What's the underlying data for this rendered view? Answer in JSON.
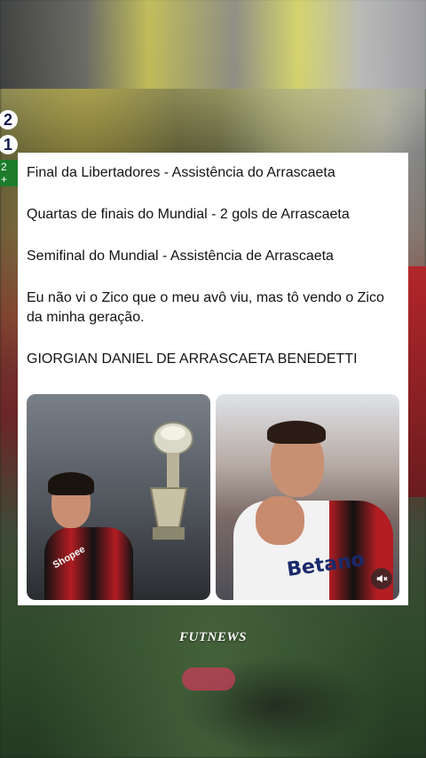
{
  "scoreboard": {
    "home": "2",
    "away": "1",
    "tag": "2 +"
  },
  "post": {
    "lines": [
      "Final da Libertadores - Assistência do Arrascaeta",
      "Quartas de finais do Mundial - 2 gols de Arrascaeta",
      "Semifinal do Mundial - Assistência de Arrascaeta",
      "Eu não vi o Zico que o meu avô viu, mas tô vendo o Zico da minha geração.",
      "GIORGIAN DANIEL DE ARRASCAETA BENEDETTI"
    ],
    "images": {
      "left_sponsor": "Shopee",
      "right_sponsor": "Betano"
    }
  },
  "watermark": "FUTNEWS",
  "colors": {
    "card_bg": "#ffffff",
    "text": "#141414",
    "flamengo_red": "#b31d23",
    "flamengo_black": "#121212"
  },
  "icons": {
    "mute": "speaker-muted-icon"
  }
}
